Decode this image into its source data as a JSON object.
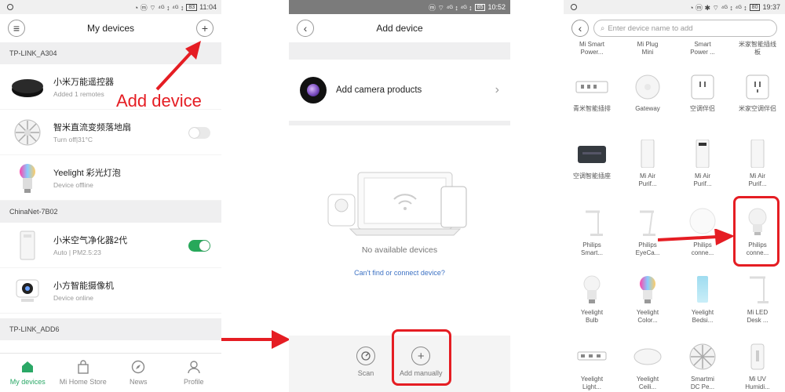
{
  "p1": {
    "status": {
      "icons": "◔ ⓜ ⌔ ⁴ᴳ ↕ ⁴ᴳ ↕",
      "battery": "83",
      "time": "11:04"
    },
    "title": "My devices",
    "menu_icon": "≡",
    "add_icon": "+",
    "annotation": "Add device",
    "sections": [
      {
        "name": "TP-LINK_A304",
        "devices": [
          {
            "name": "小米万能遥控器",
            "sub": "Added 1 remotes",
            "toggle": "none",
            "icon": "remote-icon"
          },
          {
            "name": "智米直流变频落地扇",
            "sub": "Turn off|31°C",
            "toggle": "off",
            "icon": "fan-icon"
          },
          {
            "name": "Yeelight 彩光灯泡",
            "sub": "Device offline",
            "toggle": "none",
            "icon": "bulb-icon"
          }
        ]
      },
      {
        "name": "ChinaNet-7B02",
        "devices": [
          {
            "name": "小米空气净化器2代",
            "sub": "Auto | PM2.5:23",
            "toggle": "on",
            "icon": "purifier-icon"
          },
          {
            "name": "小方智能摄像机",
            "sub": "Device online",
            "toggle": "none",
            "icon": "camera-icon"
          }
        ]
      },
      {
        "name": "TP-LINK_ADD6",
        "devices": []
      }
    ],
    "tabs": [
      {
        "label": "My devices",
        "icon": "home-icon",
        "active": true
      },
      {
        "label": "Mi Home Store",
        "icon": "bag-icon",
        "active": false
      },
      {
        "label": "News",
        "icon": "compass-icon",
        "active": false
      },
      {
        "label": "Profile",
        "icon": "person-icon",
        "active": false
      }
    ]
  },
  "p2": {
    "status": {
      "icons": "ⓜ ⌔ ⁴ᴳ ↕ ⁴ᴳ ↕",
      "battery": "85",
      "time": "10:52"
    },
    "title": "Add device",
    "back_icon": "‹",
    "camera_label": "Add camera products",
    "chevron": "›",
    "empty_text": "No available devices",
    "help_link": "Can't find or connect device?",
    "scan_label": "Scan",
    "manual_label": "Add manually",
    "plus": "+"
  },
  "p3": {
    "status": {
      "icons": "◔ ⓜ ✱ ⌔ ⁴ᴳ ↕ ⁴ᴳ ↕",
      "battery": "80",
      "time": "19:37"
    },
    "back_icon": "‹",
    "search_placeholder": "Enter device name to add",
    "search_icon": "⌕",
    "rows": [
      [
        {
          "l1": "Mi Smart",
          "l2": "Power..."
        },
        {
          "l1": "Mi Plug",
          "l2": "Mini"
        },
        {
          "l1": "Smart",
          "l2": "Power ..."
        },
        {
          "l1": "米家智能插线",
          "l2": "板"
        }
      ],
      [
        {
          "l1": "青米智能插排",
          "l2": ""
        },
        {
          "l1": "Gateway",
          "l2": ""
        },
        {
          "l1": "空调伴侣",
          "l2": ""
        },
        {
          "l1": "米家空调伴侣",
          "l2": ""
        }
      ],
      [
        {
          "l1": "空调智能插座",
          "l2": ""
        },
        {
          "l1": "Mi Air",
          "l2": "Purif..."
        },
        {
          "l1": "Mi Air",
          "l2": "Purif..."
        },
        {
          "l1": "Mi Air",
          "l2": "Purif..."
        }
      ],
      [
        {
          "l1": "Philips",
          "l2": "Smart..."
        },
        {
          "l1": "Philips",
          "l2": "EyeCa..."
        },
        {
          "l1": "Philips",
          "l2": "conne..."
        },
        {
          "l1": "Philips",
          "l2": "conne..."
        }
      ],
      [
        {
          "l1": "Yeelight",
          "l2": "Bulb"
        },
        {
          "l1": "Yeelight",
          "l2": "Color..."
        },
        {
          "l1": "Yeelight",
          "l2": "Bedsi..."
        },
        {
          "l1": "Mi LED",
          "l2": "Desk ..."
        }
      ],
      [
        {
          "l1": "Yeelight",
          "l2": "Light..."
        },
        {
          "l1": "Yeelight",
          "l2": "Ceili..."
        },
        {
          "l1": "Smartmi",
          "l2": "DC Pe..."
        },
        {
          "l1": "Mi UV",
          "l2": "Humidi..."
        }
      ]
    ]
  },
  "colors": {
    "accent": "#2aa866",
    "annotation": "#e51d23",
    "link": "#3d72c4"
  }
}
